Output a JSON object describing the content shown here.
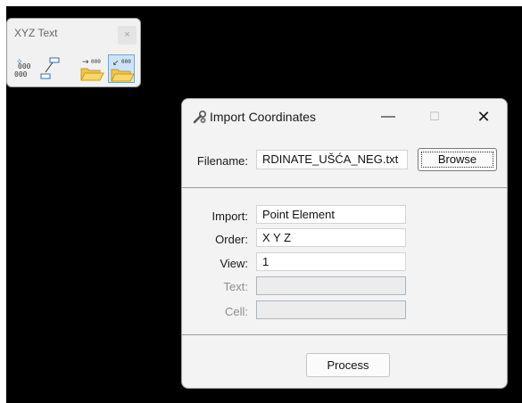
{
  "toolbox": {
    "title": "XYZ Text",
    "close_glyph": "×",
    "tools": [
      {
        "name": "xyz-text-tool",
        "icon": "xyz-points-icon"
      },
      {
        "name": "element-tool",
        "icon": "element-leader-icon"
      },
      {
        "name": "export-coordinates-tool",
        "icon": "export-folder-icon"
      },
      {
        "name": "import-coordinates-tool",
        "icon": "import-folder-icon",
        "selected": true
      }
    ]
  },
  "dialog": {
    "title": "Import Coordinates",
    "controls": {
      "minimize": "—",
      "maximize": "☐",
      "close": "✕"
    },
    "filename": {
      "label": "Filename:",
      "value": "RDINATE_UŠĆA_NEG.txt",
      "browse_label": "Browse"
    },
    "import": {
      "label": "Import:",
      "value": "Point Element"
    },
    "order": {
      "label": "Order:",
      "value": "X Y Z"
    },
    "view": {
      "label": "View:",
      "value": "1"
    },
    "text": {
      "label": "Text:",
      "value": ""
    },
    "cell": {
      "label": "Cell:",
      "value": ""
    },
    "process_label": "Process"
  },
  "colors": {
    "desktop": "#000000",
    "selected_tool": "#cde4f7",
    "folder": "#f4c542",
    "accent_blue": "#2f6fc4"
  }
}
